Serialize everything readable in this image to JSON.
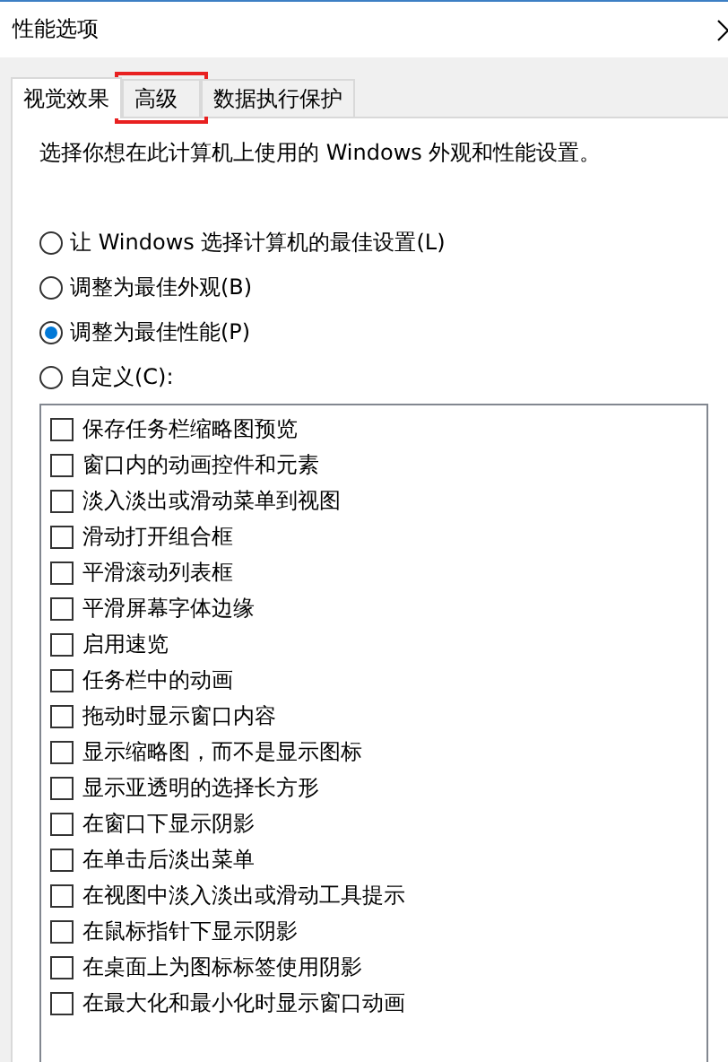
{
  "window": {
    "title": "性能选项"
  },
  "tabs": [
    {
      "label": "视觉效果",
      "selected": true
    },
    {
      "label": "高级",
      "selected": false,
      "highlighted": true
    },
    {
      "label": "数据执行保护",
      "selected": false
    }
  ],
  "description": "选择你想在此计算机上使用的 Windows 外观和性能设置。",
  "options": [
    {
      "label": "让 Windows 选择计算机的最佳设置(L)",
      "selected": false
    },
    {
      "label": "调整为最佳外观(B)",
      "selected": false
    },
    {
      "label": "调整为最佳性能(P)",
      "selected": true
    },
    {
      "label": "自定义(C):",
      "selected": false
    }
  ],
  "effects": [
    {
      "label": "保存任务栏缩略图预览",
      "checked": false
    },
    {
      "label": "窗口内的动画控件和元素",
      "checked": false
    },
    {
      "label": "淡入淡出或滑动菜单到视图",
      "checked": false
    },
    {
      "label": "滑动打开组合框",
      "checked": false
    },
    {
      "label": "平滑滚动列表框",
      "checked": false
    },
    {
      "label": "平滑屏幕字体边缘",
      "checked": false
    },
    {
      "label": "启用速览",
      "checked": false
    },
    {
      "label": "任务栏中的动画",
      "checked": false
    },
    {
      "label": "拖动时显示窗口内容",
      "checked": false
    },
    {
      "label": "显示缩略图，而不是显示图标",
      "checked": false
    },
    {
      "label": "显示亚透明的选择长方形",
      "checked": false
    },
    {
      "label": "在窗口下显示阴影",
      "checked": false
    },
    {
      "label": "在单击后淡出菜单",
      "checked": false
    },
    {
      "label": "在视图中淡入淡出或滑动工具提示",
      "checked": false
    },
    {
      "label": "在鼠标指针下显示阴影",
      "checked": false
    },
    {
      "label": "在桌面上为图标标签使用阴影",
      "checked": false
    },
    {
      "label": "在最大化和最小化时显示窗口动画",
      "checked": false
    }
  ]
}
